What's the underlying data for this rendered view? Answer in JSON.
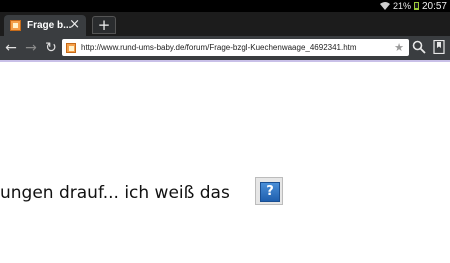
{
  "status_bar": {
    "battery": "21%",
    "battery_level": 0.21,
    "clock": "20:57",
    "icons": [
      "wifi-icon",
      "battery-icon"
    ]
  },
  "tabs": [
    {
      "title": "Frage b...",
      "icon": "site-favicon",
      "active": true
    }
  ],
  "tabstrip": {
    "close_icon": "×",
    "new_tab_icon": "+"
  },
  "toolbar": {
    "back_icon": "←",
    "forward_icon": "→",
    "reload_icon": "↻",
    "url": "http://www.rund-ums-baby.de/forum/Frage-bzgl-Kuechenwaage_4692341.htm",
    "star_icon": "★",
    "search_icon": "search-icon",
    "bookmarks_icon": "bookmarks-icon"
  },
  "page": {
    "text": "ungen drauf... ich weiß das",
    "help_icon_label": "?"
  },
  "colors": {
    "status_bar": "#000000",
    "tabstrip": "#1c1c1c",
    "toolbar": "#3a3d40",
    "progress_line": "#c9c0e8",
    "battery": "#9ccc3a",
    "help_icon": "#1f5fae"
  }
}
